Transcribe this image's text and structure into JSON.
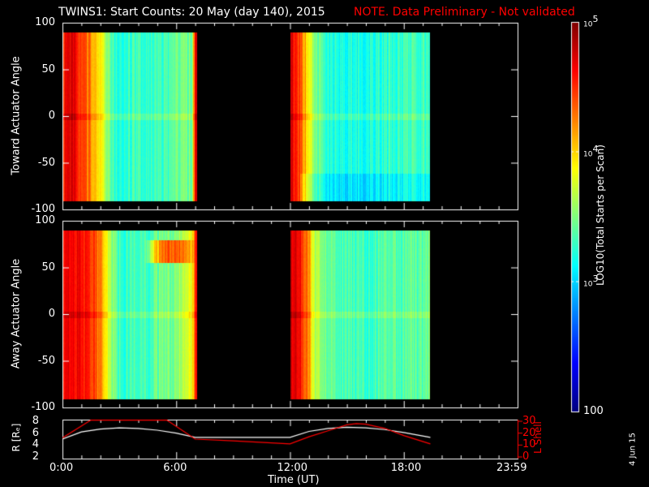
{
  "header": {
    "title": "TWINS1: Start Counts: 20 May (day 140), 2015",
    "note": "NOTE. Data Preliminary - Not validated",
    "note_color": "#ff0000"
  },
  "chart_data": [
    {
      "type": "heatmap",
      "name": "toward",
      "ylabel": "Toward Actuator Angle",
      "ylim": [
        -100,
        100
      ],
      "yticks": [
        "100",
        "50",
        "0",
        "-50",
        "-100"
      ],
      "data_angle_range": [
        -90,
        90
      ],
      "time_segments_hours": [
        [
          0,
          7.1
        ],
        [
          12.0,
          19.4
        ]
      ],
      "profile_log10": {
        "hours": [
          0,
          0.5,
          1,
          1.5,
          2,
          2.5,
          3,
          4,
          5,
          6,
          6.8,
          7.0,
          12.0,
          12.3,
          12.8,
          13.3,
          14,
          16,
          18,
          19.4
        ],
        "values": [
          4.6,
          4.7,
          4.5,
          4.2,
          3.9,
          3.4,
          3.2,
          3.3,
          3.3,
          3.4,
          3.5,
          4.7,
          4.7,
          4.6,
          4.1,
          3.5,
          3.2,
          3.2,
          3.3,
          3.3
        ]
      }
    },
    {
      "type": "heatmap",
      "name": "away",
      "ylabel": "Away Actuator Angle",
      "ylim": [
        -100,
        100
      ],
      "yticks": [
        "100",
        "50",
        "0",
        "-50",
        "-100"
      ],
      "data_angle_range": [
        -90,
        90
      ],
      "time_segments_hours": [
        [
          0,
          7.1
        ],
        [
          12.0,
          19.4
        ]
      ],
      "profile_log10": {
        "hours": [
          0,
          0.5,
          1,
          1.5,
          2,
          2.5,
          3,
          4,
          5,
          6,
          6.8,
          7.0,
          12.0,
          12.3,
          12.8,
          13.3,
          14,
          16,
          18,
          19.4
        ],
        "values": [
          4.6,
          4.7,
          4.6,
          4.5,
          4.3,
          3.6,
          3.3,
          3.3,
          3.4,
          3.5,
          3.8,
          4.5,
          4.8,
          4.7,
          4.4,
          3.7,
          3.4,
          3.3,
          3.4,
          3.4
        ]
      }
    },
    {
      "type": "line",
      "name": "orbit",
      "ylabel_left": "R [Rₑ]",
      "ylabel_right": "L Shell",
      "ylim_left": [
        2,
        8
      ],
      "ylim_right": [
        0,
        30
      ],
      "yticks_left": [
        "8",
        "6",
        "4",
        "2"
      ],
      "yticks_right": [
        "30",
        "20",
        "10",
        "0"
      ],
      "series": [
        {
          "name": "R",
          "color": "#ffffff",
          "x": [
            0,
            1,
            2,
            3,
            4,
            5,
            6,
            7,
            12,
            13,
            14,
            15,
            16,
            17,
            18,
            19.4
          ],
          "values": [
            5.0,
            6.2,
            6.7,
            6.9,
            6.8,
            6.5,
            6.0,
            5.3,
            5.3,
            6.3,
            6.8,
            7.0,
            6.9,
            6.6,
            6.1,
            5.3
          ]
        },
        {
          "name": "L Shell",
          "color": "#ff0000",
          "x": [
            0,
            1.5,
            5.5,
            7,
            9,
            12,
            13,
            14,
            15,
            15.5,
            16,
            17,
            18,
            19.4
          ],
          "values": [
            16,
            31,
            31,
            15,
            13.5,
            11,
            17,
            22,
            27,
            28,
            27.5,
            24,
            18,
            11
          ]
        }
      ]
    },
    {
      "type": "colorbar",
      "label": "LOG10(Total Starts per Scan)",
      "range_log10": [
        2,
        5
      ],
      "ticks": [
        "10^5",
        "10^4",
        "10^3",
        "100"
      ]
    }
  ],
  "xaxis": {
    "label": "Time (UT)",
    "ticks": [
      "0:00",
      "6:00",
      "12:00",
      "18:00",
      "23:59"
    ]
  },
  "footer": {
    "date": "4 Jun 15"
  }
}
